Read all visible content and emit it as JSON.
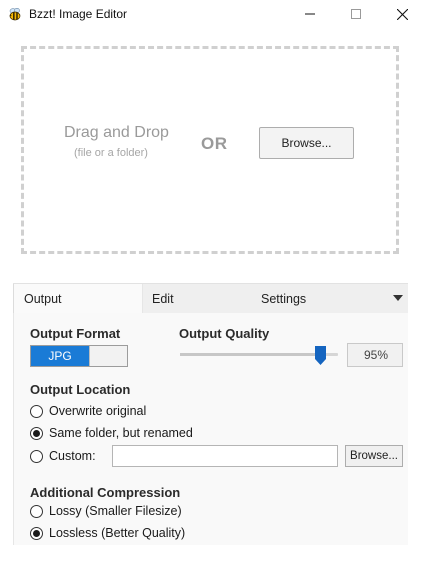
{
  "window": {
    "title": "Bzzt! Image Editor",
    "app_icon": "bee-icon",
    "controls": [
      "minimize-icon",
      "maximize-icon",
      "close-icon"
    ]
  },
  "dropzone": {
    "title": "Drag and Drop",
    "subtitle": "(file or a folder)",
    "or_label": "OR",
    "browse_label": "Browse..."
  },
  "tabs": {
    "output": "Output",
    "edit": "Edit",
    "settings": "Settings"
  },
  "output": {
    "format": {
      "heading": "Output Format",
      "selected": "JPG"
    },
    "quality": {
      "heading": "Output Quality",
      "value_label": "95%",
      "value": 0.95
    },
    "location": {
      "heading": "Output Location",
      "options": [
        "Overwrite original",
        "Same folder, but renamed",
        "Custom:"
      ],
      "selected_index": 1,
      "custom_path": "",
      "browse_label": "Browse..."
    },
    "compression": {
      "heading": "Additional Compression",
      "options": [
        "Lossy (Smaller Filesize)",
        "Lossless (Better Quality)"
      ],
      "selected_index": 1
    }
  },
  "colors": {
    "accent": "#1a7bd6",
    "slider_thumb": "#1565c0"
  }
}
